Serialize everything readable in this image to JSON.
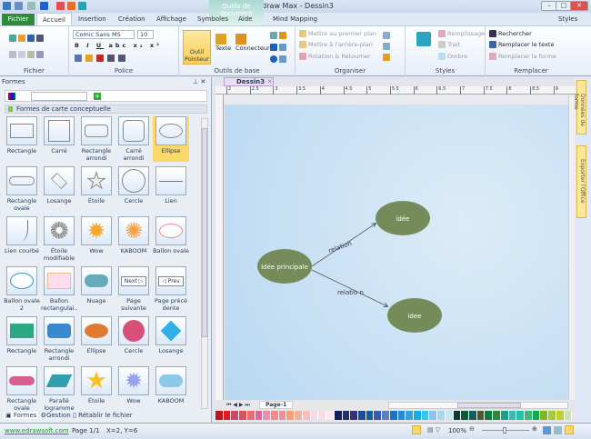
{
  "window": {
    "title": "Edraw Max - Dessin3",
    "context_tab": "Outils de document",
    "styles_label": "Styles"
  },
  "tabs": [
    "Fichier",
    "Accueil",
    "Insertion",
    "Création",
    "Affichage",
    "Symboles",
    "Aide",
    "Mind Mapping"
  ],
  "ribbon": {
    "groups": [
      "Fichier",
      "Police",
      "Outils de base",
      "Organiser",
      "Styles",
      "Remplacer"
    ],
    "font_name": "Comic Sans MS",
    "font_size": "10",
    "pointer_label": "Outil Pointeur",
    "text_label": "Texte",
    "connector_label": "Connecteur",
    "organise": [
      "Mettre au premier plan",
      "Mettre à l'arrière-plan",
      "Rotation & Retourner"
    ],
    "styles": [
      "Remplissage",
      "Trait",
      "Ombre"
    ],
    "replace": [
      "Rechercher",
      "Remplacer le texte",
      "Remplacer la forme"
    ]
  },
  "shapes_panel": {
    "title": "Formes",
    "category": "Formes de carte conceptuelle",
    "items": [
      "Rectangle",
      "Carré",
      "Rectangle arrondi",
      "Carré arrondi",
      "Ellipse",
      "Rectangle ovale",
      "Losange",
      "Étoile",
      "Cercle",
      "Lien",
      "Lien courbé",
      "Étoile modifiable",
      "Wow",
      "KABOOM",
      "Ballon ovale",
      "Ballon ovale 2",
      "Ballon rectangulai...",
      "Nuage",
      "Page suivante",
      "Page précé dente",
      "Rectangle",
      "Rectangle arrondi",
      "Ellipse",
      "Cercle",
      "Losange",
      "Rectangle ovale",
      "Parallé logramme",
      "Étoile",
      "Wow",
      "KABOOM"
    ],
    "bottom_tabs": [
      "Formes",
      "Gestion",
      "Rétablir le fichier"
    ]
  },
  "document": {
    "tab": "Dessin3",
    "page_tab": "Page-1",
    "ruler": [
      "2",
      "2.5",
      "3",
      "3.5",
      "4",
      "4.5",
      "5",
      "5.5",
      "6",
      "6.5",
      "7",
      "7.5",
      "8",
      "8.5",
      "9"
    ],
    "nodes": {
      "main": "Idée principale",
      "top": "idée",
      "bottom": "idee"
    },
    "edges": {
      "top": "relation",
      "bottom": "relatio n"
    },
    "node_color": "#758c5a"
  },
  "side_tabs": [
    "Données de forme",
    "Exporter l'Office"
  ],
  "palette": [
    "#c0141c",
    "#e01b24",
    "#c84a6a",
    "#e0505c",
    "#ec6a70",
    "#e4609c",
    "#e890b0",
    "#f08a8a",
    "#f2909a",
    "#f8a070",
    "#f6b0a0",
    "#fac0b8",
    "#ecdcec",
    "#fadce6",
    "#fce8ec",
    "#14205a",
    "#20306e",
    "#3c2c7a",
    "#1a4c90",
    "#10609e",
    "#3a5cae",
    "#5a80c0",
    "#1a74c4",
    "#2a88d0",
    "#36a0dc",
    "#10b0ea",
    "#3ac4f0",
    "#8cc4ec",
    "#a8d8f0",
    "#c8e6f4",
    "#0c3c2c",
    "#0c5a3c",
    "#10605a",
    "#4a5c2a",
    "#0c7a40",
    "#2a8a3a",
    "#18a08a",
    "#40b8b0",
    "#20c4a0",
    "#3cb878",
    "#10a850",
    "#80b818",
    "#a8c840",
    "#c0d030",
    "#c8e4b0"
  ],
  "status": {
    "link": "www.edrawsoft.com",
    "page": "Page 1/1",
    "coords": "X=2, Y=6",
    "zoom": "100%"
  }
}
